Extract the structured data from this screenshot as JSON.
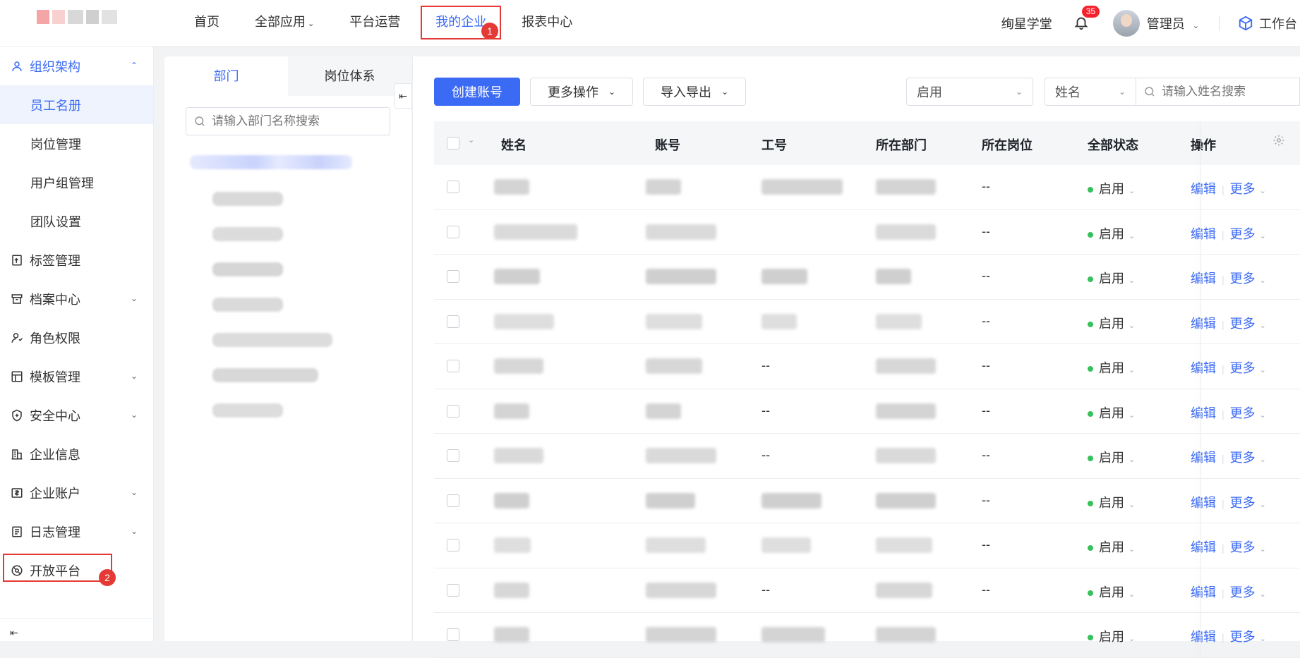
{
  "topnav": {
    "items": [
      "首页",
      "全部应用",
      "平台运营",
      "我的企业",
      "报表中心"
    ],
    "active_index": 3,
    "right": {
      "link": "绚星学堂",
      "notification_count": "35",
      "user": "管理员",
      "workbench": "工作台"
    }
  },
  "annotations": {
    "marker1": "1",
    "marker2": "2"
  },
  "sidebar": {
    "items": [
      {
        "label": "组织架构",
        "icon": "org-icon",
        "expandable": true,
        "open": true
      },
      {
        "label": "员工名册",
        "sub": true,
        "active": true
      },
      {
        "label": "岗位管理",
        "sub": true
      },
      {
        "label": "用户组管理",
        "sub": true
      },
      {
        "label": "团队设置",
        "sub": true
      },
      {
        "label": "标签管理",
        "icon": "tag-icon"
      },
      {
        "label": "档案中心",
        "icon": "archive-icon",
        "expandable": true
      },
      {
        "label": "角色权限",
        "icon": "role-icon"
      },
      {
        "label": "模板管理",
        "icon": "template-icon",
        "expandable": true
      },
      {
        "label": "安全中心",
        "icon": "shield-icon",
        "expandable": true
      },
      {
        "label": "企业信息",
        "icon": "building-icon"
      },
      {
        "label": "企业账户",
        "icon": "account-icon",
        "expandable": true
      },
      {
        "label": "日志管理",
        "icon": "log-icon",
        "expandable": true
      },
      {
        "label": "开放平台",
        "icon": "open-platform-icon"
      }
    ]
  },
  "dept_panel": {
    "tabs": [
      "部门",
      "岗位体系"
    ],
    "search_placeholder": "请输入部门名称搜索"
  },
  "toolbar": {
    "create": "创建账号",
    "more": "更多操作",
    "import_export": "导入导出"
  },
  "filters": {
    "status": "启用",
    "field": "姓名",
    "search_placeholder": "请输入姓名搜索"
  },
  "table": {
    "columns": [
      "姓名",
      "账号",
      "工号",
      "所在部门",
      "所在岗位",
      "全部状态",
      "操作"
    ],
    "rows": [
      {
        "gonghao_shown": false,
        "post": "--",
        "status": "启用"
      },
      {
        "gonghao_shown": false,
        "post": "--",
        "status": "启用"
      },
      {
        "gonghao_shown": false,
        "post": "--",
        "status": "启用"
      },
      {
        "gonghao_shown": false,
        "post": "--",
        "status": "启用"
      },
      {
        "gonghao": "--",
        "post": "--",
        "status": "启用"
      },
      {
        "gonghao": "--",
        "post": "--",
        "status": "启用"
      },
      {
        "gonghao": "--",
        "post": "--",
        "status": "启用"
      },
      {
        "gonghao_shown": false,
        "post": "--",
        "status": "启用"
      },
      {
        "gonghao_shown": false,
        "post": "--",
        "status": "启用"
      },
      {
        "gonghao": "--",
        "post": "--",
        "status": "启用"
      },
      {
        "gonghao_shown": false,
        "post": "",
        "status": "启用"
      }
    ],
    "op_edit": "编辑",
    "op_more": "更多"
  },
  "colors": {
    "accent": "#3b6af5",
    "status_green": "#36c15a",
    "annotation_red": "#e53935"
  }
}
